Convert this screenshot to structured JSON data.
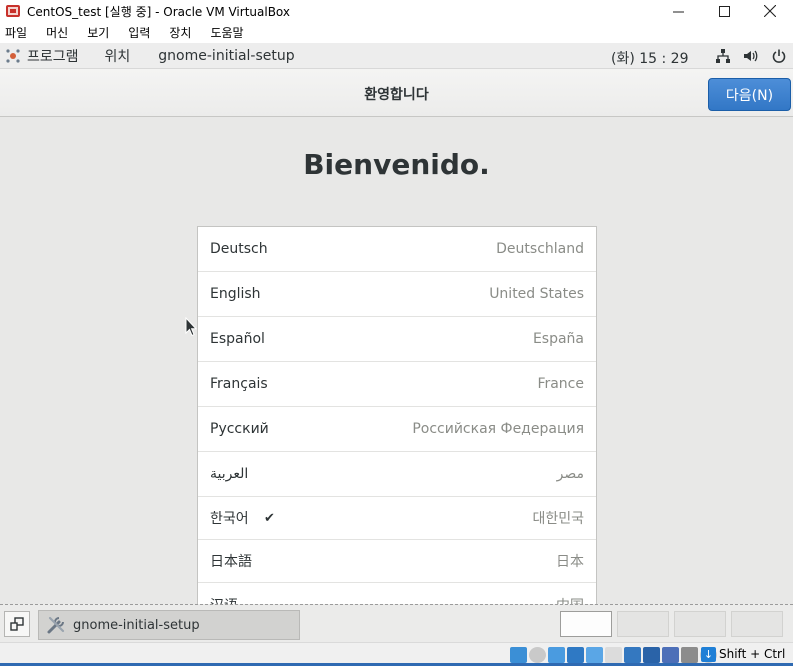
{
  "window": {
    "title": "CentOS_test [실행 중] - Oracle VM VirtualBox",
    "controls": {
      "minimize": "—",
      "maximize": "☐",
      "close": "✕"
    }
  },
  "vb_menu": [
    "파일",
    "머신",
    "보기",
    "입력",
    "장치",
    "도움말"
  ],
  "gnome_topbar": {
    "applications": "프로그램",
    "places": "위치",
    "active_app": "gnome-initial-setup",
    "clock": "(화) 15 : 29",
    "tray_icons": [
      "network-icon",
      "volume-icon",
      "power-icon"
    ]
  },
  "setup": {
    "header_title": "환영합니다",
    "next_button": "다음(N)",
    "welcome_heading": "Bienvenido.",
    "languages": [
      {
        "name": "Deutsch",
        "region": "Deutschland",
        "selected": false
      },
      {
        "name": "English",
        "region": "United States",
        "selected": false
      },
      {
        "name": "Español",
        "region": "España",
        "selected": false
      },
      {
        "name": "Français",
        "region": "France",
        "selected": false
      },
      {
        "name": "Русский",
        "region": "Российская Федерация",
        "selected": false
      },
      {
        "name": "العربية",
        "region": "مصر",
        "selected": false
      },
      {
        "name": "한국어",
        "region": "대한민국",
        "selected": true,
        "check": "✔"
      },
      {
        "name": "日本語",
        "region": "日本",
        "selected": false
      },
      {
        "name": "汉语",
        "region": "中国",
        "selected": false
      }
    ]
  },
  "gnome_bottombar": {
    "window_button": "gnome-initial-setup",
    "workspaces": 4,
    "active_workspace": 1
  },
  "vb_status": {
    "host_key": "Shift + Ctrl"
  },
  "colors": {
    "accent_button": "#3277c6",
    "guest_background": "#e8e8e7",
    "region_text": "#8a8c87"
  }
}
